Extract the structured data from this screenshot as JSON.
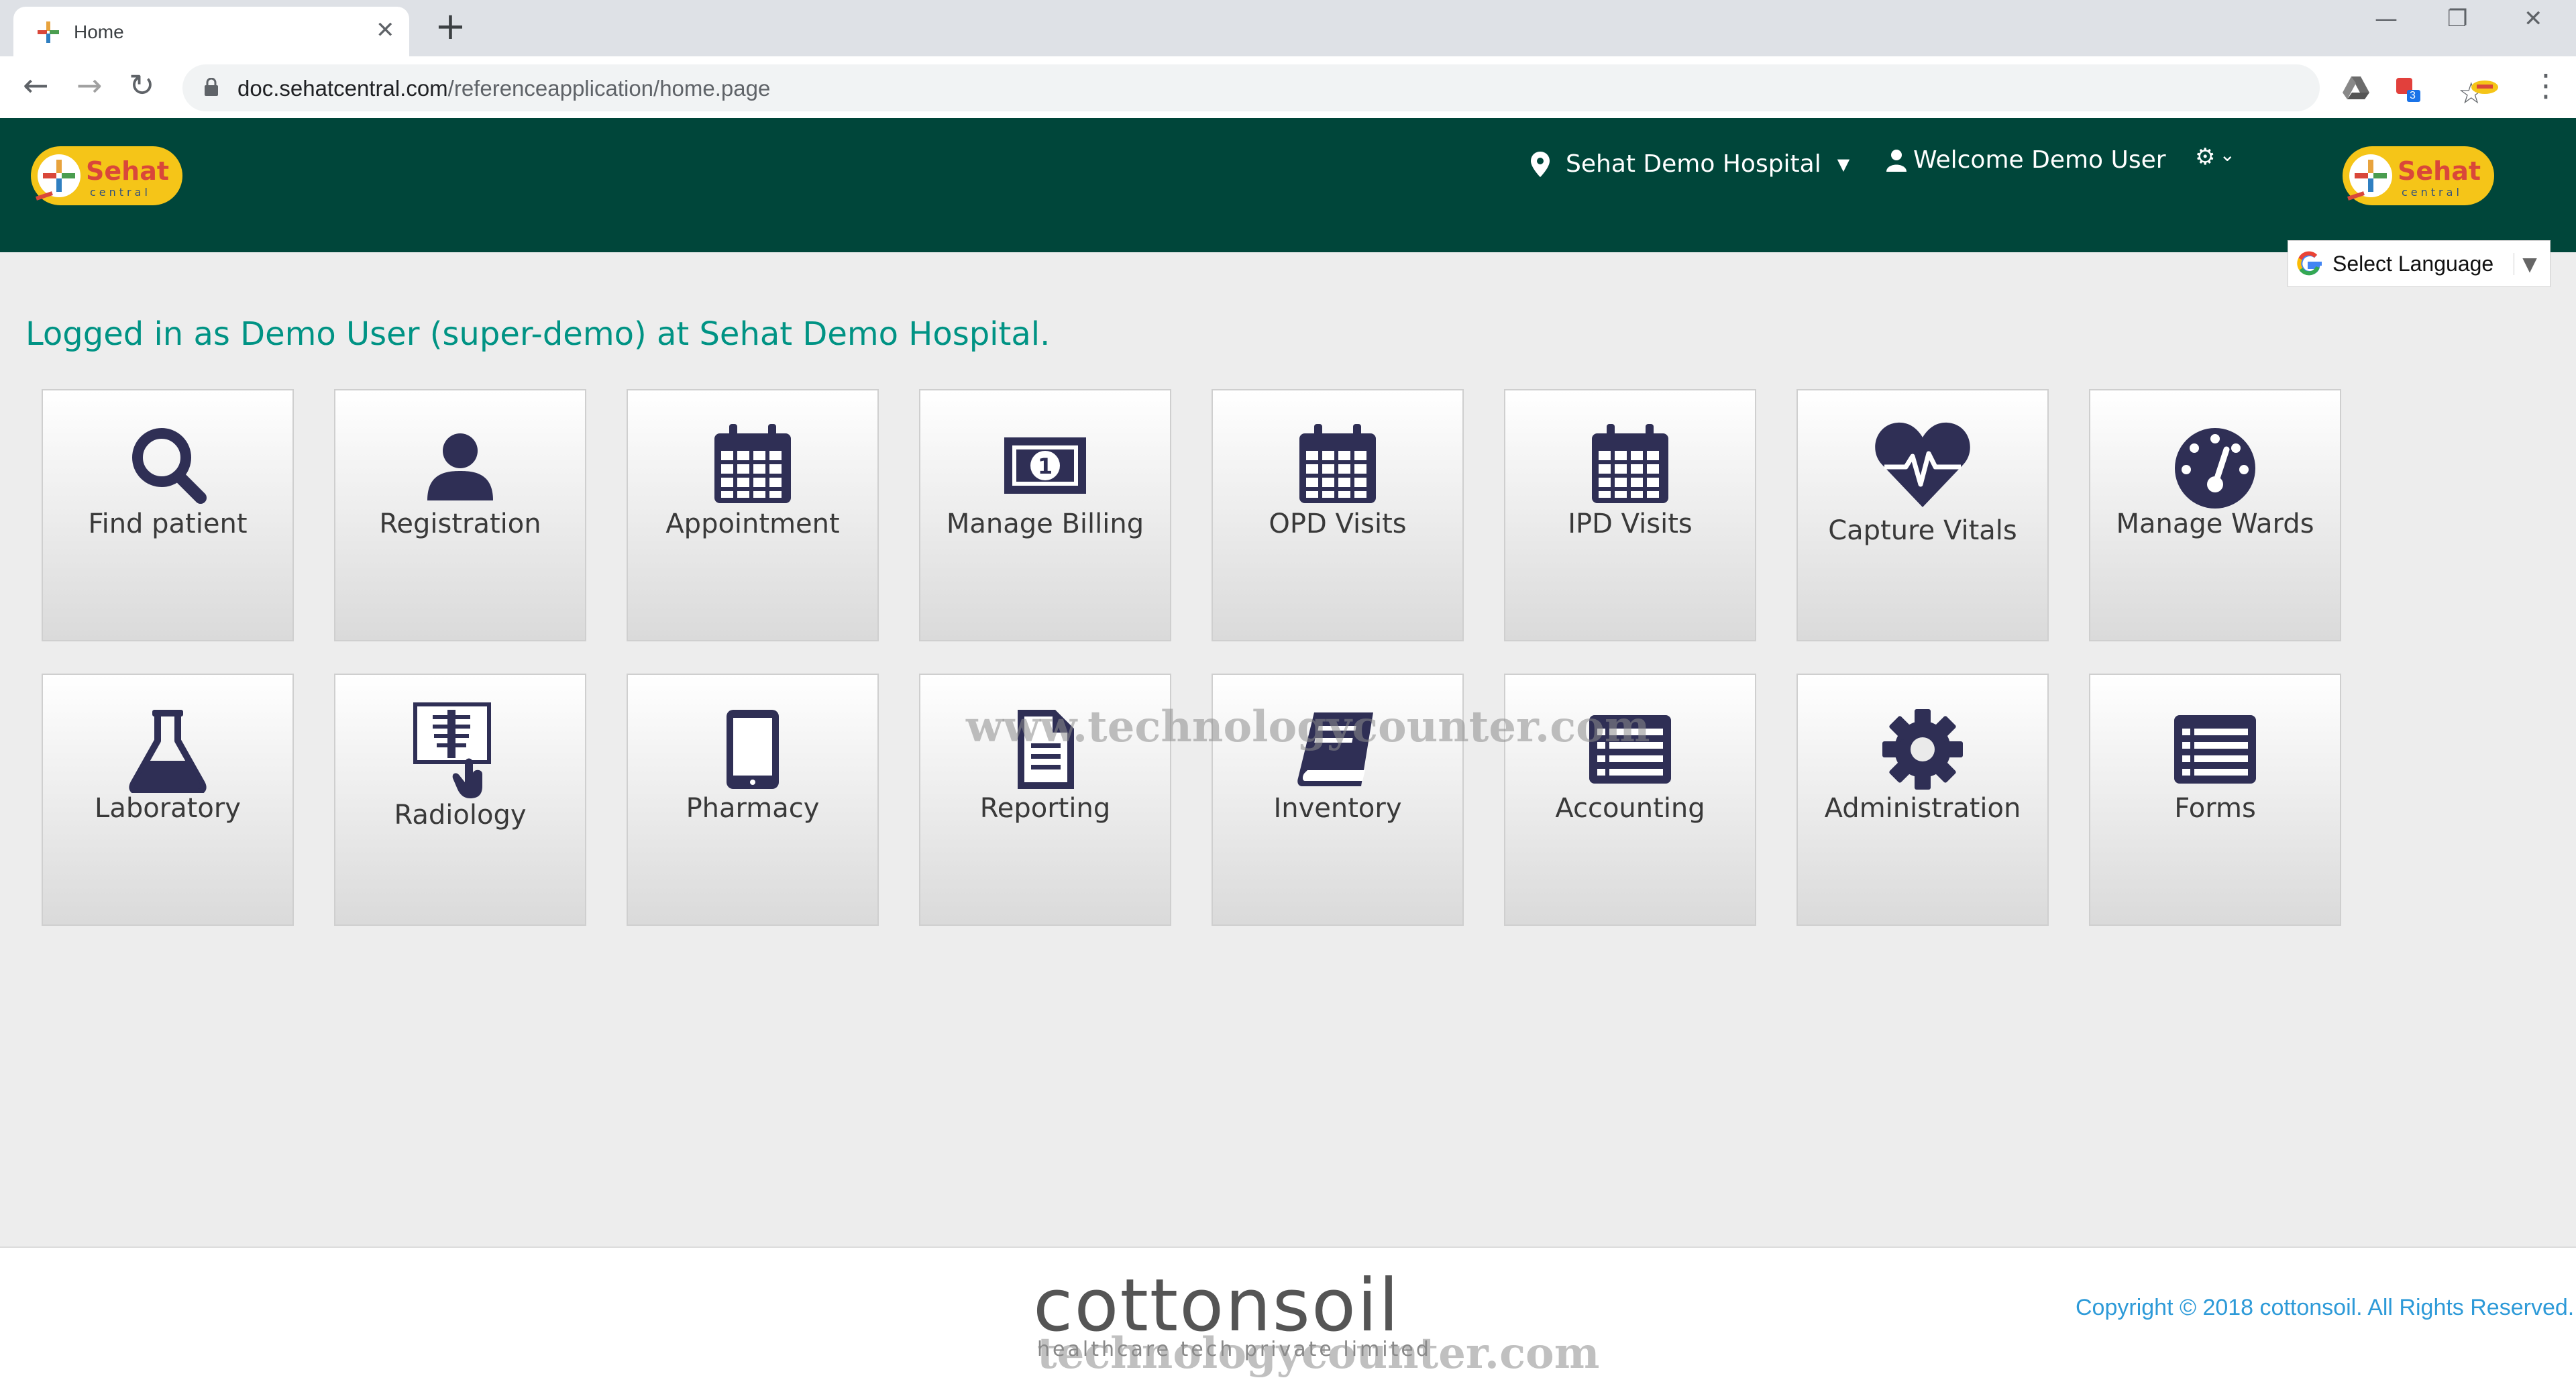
{
  "browser": {
    "tab_title": "Home",
    "url_domain": "doc.sehatcentral.com",
    "url_path": "/referenceapplication/home.page",
    "extension_badge": "3"
  },
  "header": {
    "logo_text": "Sehat",
    "logo_sub": "central",
    "location": "Sehat Demo Hospital",
    "welcome": "Welcome Demo User",
    "language_label": "Select Language"
  },
  "main": {
    "logged_in_text": "Logged in as Demo User (super-demo) at Sehat Demo Hospital.",
    "tiles": [
      {
        "label": "Find patient",
        "icon": "search-icon"
      },
      {
        "label": "Registration",
        "icon": "user-icon"
      },
      {
        "label": "Appointment",
        "icon": "calendar-icon"
      },
      {
        "label": "Manage Billing",
        "icon": "money-icon"
      },
      {
        "label": "OPD Visits",
        "icon": "calendar-icon"
      },
      {
        "label": "IPD Visits",
        "icon": "calendar-icon"
      },
      {
        "label": "Capture Vitals",
        "icon": "heartbeat-icon"
      },
      {
        "label": "Manage Wards",
        "icon": "dashboard-icon"
      },
      {
        "label": "Laboratory",
        "icon": "flask-icon"
      },
      {
        "label": "Radiology",
        "icon": "xray-icon"
      },
      {
        "label": "Pharmacy",
        "icon": "tablet-icon"
      },
      {
        "label": "Reporting",
        "icon": "file-icon"
      },
      {
        "label": "Inventory",
        "icon": "book-icon"
      },
      {
        "label": "Accounting",
        "icon": "list-icon"
      },
      {
        "label": "Administration",
        "icon": "gear-icon"
      },
      {
        "label": "Forms",
        "icon": "list-icon"
      }
    ]
  },
  "footer": {
    "brand": "cottonsoil",
    "brand_sub": "healthcare tech private limited",
    "copyright": "Copyright © 2018 cottonsoil. All Rights Reserved."
  },
  "watermark": {
    "text_1": "www.technologycounter.com",
    "text_2": "technologycounter.com"
  },
  "colors": {
    "header_bg": "#00463a",
    "accent_text": "#009384",
    "icon_color": "#2f2f55",
    "copyright": "#2d9ad8"
  }
}
